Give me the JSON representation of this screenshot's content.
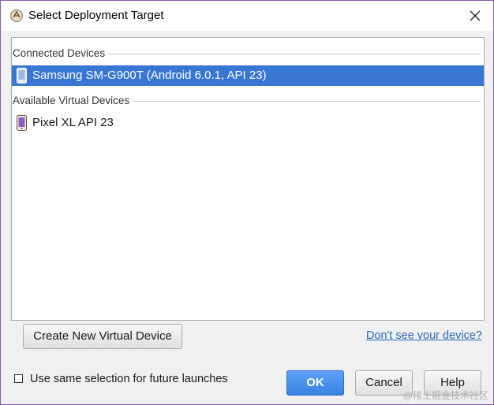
{
  "window": {
    "title": "Select Deployment Target",
    "app_icon": "android-studio-icon",
    "close_icon": "close-icon"
  },
  "device_list": {
    "sections": [
      {
        "header": "Connected Devices",
        "devices": [
          {
            "name": "Samsung SM-G900T (Android 6.0.1, API 23)",
            "icon": "phone-device-icon",
            "selected": true
          }
        ]
      },
      {
        "header": "Available Virtual Devices",
        "devices": [
          {
            "name": "Pixel XL API 23",
            "icon": "virtual-phone-icon",
            "selected": false
          }
        ]
      }
    ]
  },
  "actions": {
    "create_label": "Create New Virtual Device",
    "help_link": "Don't see your device?"
  },
  "options": {
    "checkbox_label": "Use same selection for future launches",
    "checkbox_checked": false
  },
  "footer": {
    "ok_label": "OK",
    "cancel_label": "Cancel",
    "help_label": "Help"
  },
  "watermark": "@稀土掘金技术社区",
  "colors": {
    "selection": "#3876d4",
    "ok_button": "#3a82e4",
    "link": "#2a6ab8"
  }
}
